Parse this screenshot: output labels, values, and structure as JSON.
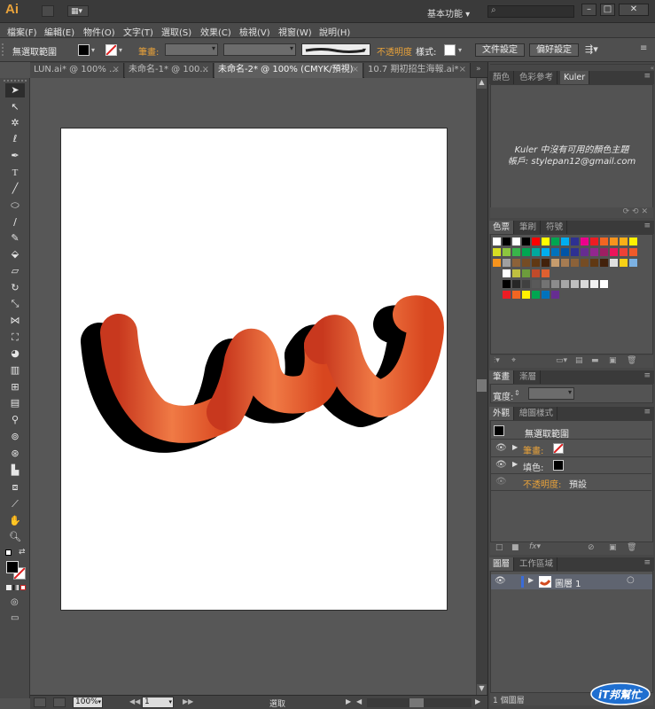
{
  "app": {
    "logo": "Ai",
    "workspace": "基本功能",
    "search_placeholder": ""
  },
  "menu": [
    "檔案(F)",
    "編輯(E)",
    "物件(O)",
    "文字(T)",
    "選取(S)",
    "效果(C)",
    "檢視(V)",
    "視窗(W)",
    "說明(H)"
  ],
  "control": {
    "selection_label": "無選取範圍",
    "stroke_label": "筆畫:",
    "opacity_label": "不透明度",
    "style_label": "樣式:",
    "doc_setup": "文件設定",
    "prefs": "偏好設定"
  },
  "tabs": [
    {
      "label": "LUN.ai* @ 100% ...",
      "active": false
    },
    {
      "label": "未命名-1* @ 100...",
      "active": false
    },
    {
      "label": "未命名-2* @ 100% (CMYK/預視)",
      "active": true
    },
    {
      "label": "10.7 期初招生海報.ai*",
      "active": false
    }
  ],
  "kuler": {
    "tabs": [
      "顏色",
      "色彩參考",
      "Kuler"
    ],
    "message_line1": "Kuler 中沒有可用的顏色主題",
    "message_line2": "帳戶: stylepan12@gmail.com"
  },
  "swatches_panel": {
    "tabs": [
      "色票",
      "筆刷",
      "符號"
    ]
  },
  "stroke_panel": {
    "tabs": [
      "筆畫",
      "漸層"
    ],
    "weight_label": "寬度:"
  },
  "appearance": {
    "tabs": [
      "外觀",
      "繪圖樣式"
    ],
    "header": "無選取範圍",
    "rows": [
      {
        "label": "筆畫:",
        "value": ""
      },
      {
        "label": "填色:",
        "value": ""
      },
      {
        "label": "不透明度:",
        "value": "預設"
      }
    ]
  },
  "layers": {
    "tabs": [
      "圖層",
      "工作區域"
    ],
    "layer_name": "圖層 1",
    "count": "1 個圖層"
  },
  "status": {
    "zoom": "100%",
    "page": "1",
    "tool": "選取"
  },
  "watermark": {
    "text": "iT邦幫忙"
  },
  "colors": {
    "accent": "#e8a23a",
    "artwork_dark": "#c8381e",
    "artwork_light": "#f07a45"
  }
}
